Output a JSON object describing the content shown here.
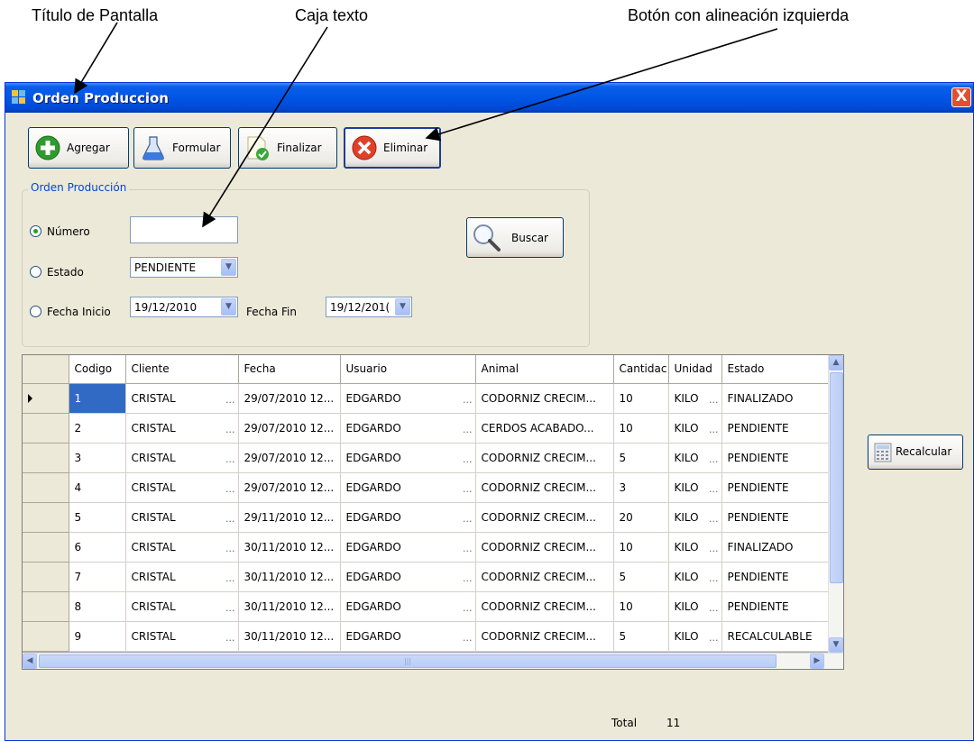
{
  "annotations": {
    "screen_title": "Título de Pantalla",
    "text_box": "Caja texto",
    "left_aligned_button": "Botón con alineación izquierda"
  },
  "window": {
    "title": "Orden Produccion",
    "close": "X"
  },
  "toolbar": {
    "agregar": "Agregar",
    "formular": "Formular",
    "finalizar": "Finalizar",
    "eliminar": "Eliminar"
  },
  "filter": {
    "group_label": "Orden Producción",
    "numero_label": "Número",
    "numero_value": "",
    "estado_label": "Estado",
    "estado_value": "PENDIENTE",
    "fecha_inicio_label": "Fecha Inicio",
    "fecha_inicio_value": "19/12/2010",
    "fecha_fin_label": "Fecha Fin",
    "fecha_fin_value": "19/12/201(",
    "buscar": "Buscar",
    "selected_option": "Número"
  },
  "grid": {
    "columns": [
      "Codigo",
      "Cliente",
      "Fecha",
      "Usuario",
      "Animal",
      "Cantidac",
      "Unidad",
      "Estado"
    ],
    "rows": [
      [
        "1",
        "CRISTAL",
        "29/07/2010 12...",
        "EDGARDO",
        "CODORNIZ CRECIM...",
        "10",
        "KILO",
        "FINALIZADO"
      ],
      [
        "2",
        "CRISTAL",
        "29/07/2010 12...",
        "EDGARDO",
        "CERDOS ACABADO...",
        "10",
        "KILO",
        "PENDIENTE"
      ],
      [
        "3",
        "CRISTAL",
        "29/07/2010 12...",
        "EDGARDO",
        "CODORNIZ CRECIM...",
        "5",
        "KILO",
        "PENDIENTE"
      ],
      [
        "4",
        "CRISTAL",
        "29/07/2010 12...",
        "EDGARDO",
        "CODORNIZ CRECIM...",
        "3",
        "KILO",
        "PENDIENTE"
      ],
      [
        "5",
        "CRISTAL",
        "29/11/2010 12...",
        "EDGARDO",
        "CODORNIZ CRECIM...",
        "20",
        "KILO",
        "PENDIENTE"
      ],
      [
        "6",
        "CRISTAL",
        "30/11/2010 12...",
        "EDGARDO",
        "CODORNIZ CRECIM...",
        "10",
        "KILO",
        "FINALIZADO"
      ],
      [
        "7",
        "CRISTAL",
        "30/11/2010 12...",
        "EDGARDO",
        "CODORNIZ CRECIM...",
        "5",
        "KILO",
        "PENDIENTE"
      ],
      [
        "8",
        "CRISTAL",
        "30/11/2010 12...",
        "EDGARDO",
        "CODORNIZ CRECIM...",
        "10",
        "KILO",
        "PENDIENTE"
      ],
      [
        "9",
        "CRISTAL",
        "30/11/2010 12...",
        "EDGARDO",
        "CODORNIZ CRECIM...",
        "5",
        "KILO",
        "RECALCULABLE"
      ]
    ],
    "ellipsis": "..."
  },
  "side": {
    "recalcular": "Recalcular"
  },
  "footer": {
    "total_label": "Total",
    "total_value": "11"
  }
}
